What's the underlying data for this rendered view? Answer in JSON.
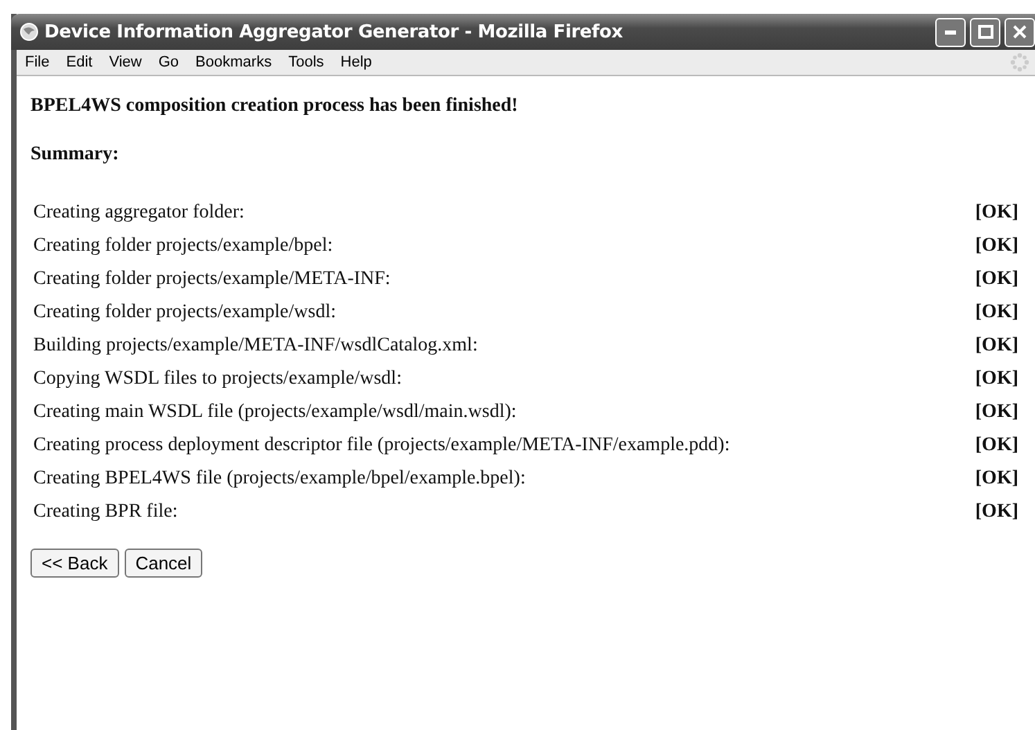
{
  "window": {
    "title": "Device Information Aggregator Generator - Mozilla Firefox"
  },
  "menu": [
    {
      "label": "File"
    },
    {
      "label": "Edit"
    },
    {
      "label": "View"
    },
    {
      "label": "Go"
    },
    {
      "label": "Bookmarks"
    },
    {
      "label": "Tools"
    },
    {
      "label": "Help"
    }
  ],
  "heading": "BPEL4WS composition creation process has been finished!",
  "summary_label": "Summary:",
  "steps": [
    {
      "text": "Creating aggregator folder:",
      "status": "[OK]"
    },
    {
      "text": "Creating folder projects/example/bpel:",
      "status": "[OK]"
    },
    {
      "text": "Creating folder projects/example/META-INF:",
      "status": "[OK]"
    },
    {
      "text": "Creating folder projects/example/wsdl:",
      "status": "[OK]"
    },
    {
      "text": "Building projects/example/META-INF/wsdlCatalog.xml:",
      "status": "[OK]"
    },
    {
      "text": "Copying WSDL files to projects/example/wsdl:",
      "status": "[OK]"
    },
    {
      "text": "Creating main WSDL file (projects/example/wsdl/main.wsdl):",
      "status": "[OK]"
    },
    {
      "text": "Creating process deployment descriptor file (projects/example/META-INF/example.pdd):",
      "status": "[OK]"
    },
    {
      "text": "Creating BPEL4WS file (projects/example/bpel/example.bpel):",
      "status": "[OK]"
    },
    {
      "text": "Creating BPR file:",
      "status": "[OK]"
    }
  ],
  "buttons": [
    {
      "label": "<< Back"
    },
    {
      "label": "Cancel"
    }
  ]
}
